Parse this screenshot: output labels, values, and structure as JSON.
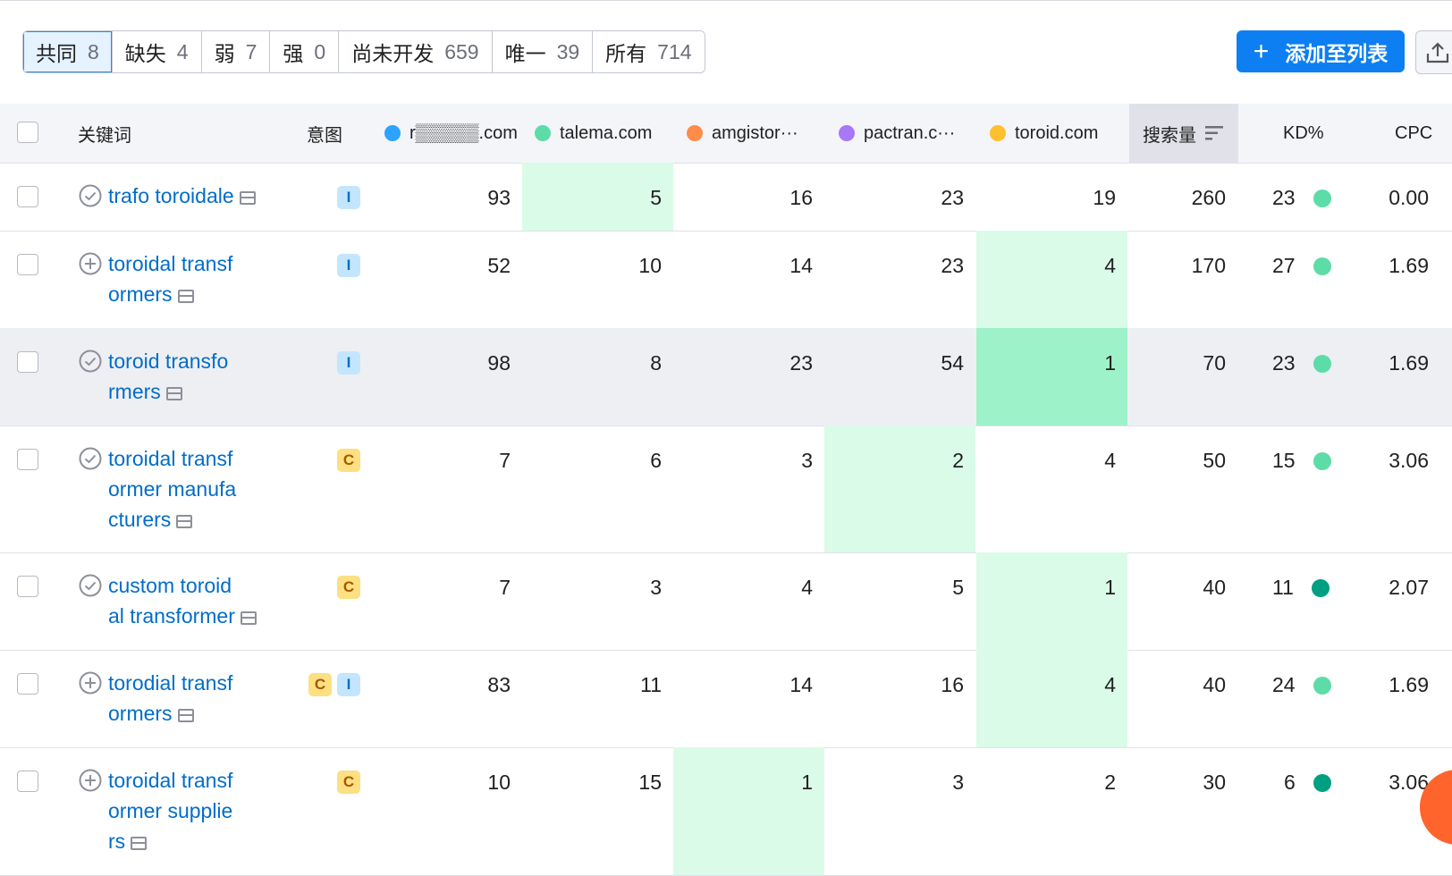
{
  "filters": [
    {
      "label": "共同",
      "count": "8",
      "active": true
    },
    {
      "label": "缺失",
      "count": "4",
      "active": false
    },
    {
      "label": "弱",
      "count": "7",
      "active": false
    },
    {
      "label": "强",
      "count": "0",
      "active": false
    },
    {
      "label": "尚未开发",
      "count": "659",
      "active": false
    },
    {
      "label": "唯一",
      "count": "39",
      "active": false
    },
    {
      "label": "所有",
      "count": "714",
      "active": false
    }
  ],
  "toolbar": {
    "add_label": "添加至列表",
    "add_icon": "plus-icon",
    "export_icon": "upload-icon"
  },
  "columns": {
    "keyword": "关键词",
    "intent": "意图",
    "domains": [
      {
        "name": "r▒▒▒▒▒.com",
        "color": "#2da3ff"
      },
      {
        "name": "talema.com",
        "color": "#5ddca8"
      },
      {
        "name": "amgistor···",
        "color": "#ff8c4b"
      },
      {
        "name": "pactran.c···",
        "color": "#a878f6"
      },
      {
        "name": "toroid.com",
        "color": "#ffbf2e"
      }
    ],
    "volume": "搜索量",
    "kd": "KD%",
    "cpc": "CPC"
  },
  "rows": [
    {
      "keyword": "trafo toroidale",
      "status": "check",
      "intent": [
        "I"
      ],
      "ranks": [
        "93",
        "5",
        "16",
        "23",
        "19"
      ],
      "best": [
        1
      ],
      "volume": "260",
      "kd": "23",
      "kd_color": "#5ddca8",
      "cpc": "0.00"
    },
    {
      "keyword": "toroidal transformers",
      "kw_lines": [
        "toroidal transf",
        "ormers"
      ],
      "status": "add",
      "intent": [
        "I"
      ],
      "ranks": [
        "52",
        "10",
        "14",
        "23",
        "4"
      ],
      "best": [
        4
      ],
      "volume": "170",
      "kd": "27",
      "kd_color": "#5ddca8",
      "cpc": "1.69"
    },
    {
      "keyword": "toroid transformers",
      "kw_lines": [
        "toroid transfo",
        "rmers"
      ],
      "status": "check",
      "intent": [
        "I"
      ],
      "ranks": [
        "98",
        "8",
        "23",
        "54",
        "1"
      ],
      "best": [
        4
      ],
      "volume": "70",
      "kd": "23",
      "kd_color": "#5ddca8",
      "cpc": "1.69",
      "highlight": true
    },
    {
      "keyword": "toroidal transformer manufacturers",
      "kw_lines": [
        "toroidal transf",
        "ormer manufa",
        "cturers"
      ],
      "status": "check",
      "intent": [
        "C"
      ],
      "ranks": [
        "7",
        "6",
        "3",
        "2",
        "4"
      ],
      "best": [
        3
      ],
      "volume": "50",
      "kd": "15",
      "kd_color": "#5ddca8",
      "cpc": "3.06"
    },
    {
      "keyword": "custom toroidal transformer",
      "kw_lines": [
        "custom toroid",
        "al transformer"
      ],
      "status": "check",
      "intent": [
        "C"
      ],
      "ranks": [
        "7",
        "3",
        "4",
        "5",
        "1"
      ],
      "best": [
        4
      ],
      "volume": "40",
      "kd": "11",
      "kd_color": "#009f81",
      "cpc": "2.07"
    },
    {
      "keyword": "torodial transformers",
      "kw_lines": [
        "torodial transf",
        "ormers"
      ],
      "status": "add",
      "intent": [
        "C",
        "I"
      ],
      "ranks": [
        "83",
        "11",
        "14",
        "16",
        "4"
      ],
      "best": [
        4
      ],
      "volume": "40",
      "kd": "24",
      "kd_color": "#5ddca8",
      "cpc": "1.69"
    },
    {
      "keyword": "toroidal transformer suppliers",
      "kw_lines": [
        "toroidal transf",
        "ormer supplie",
        "rs"
      ],
      "status": "add",
      "intent": [
        "C"
      ],
      "ranks": [
        "10",
        "15",
        "1",
        "3",
        "2"
      ],
      "best": [
        2
      ],
      "volume": "30",
      "kd": "6",
      "kd_color": "#009f81",
      "cpc": "3.06"
    }
  ]
}
